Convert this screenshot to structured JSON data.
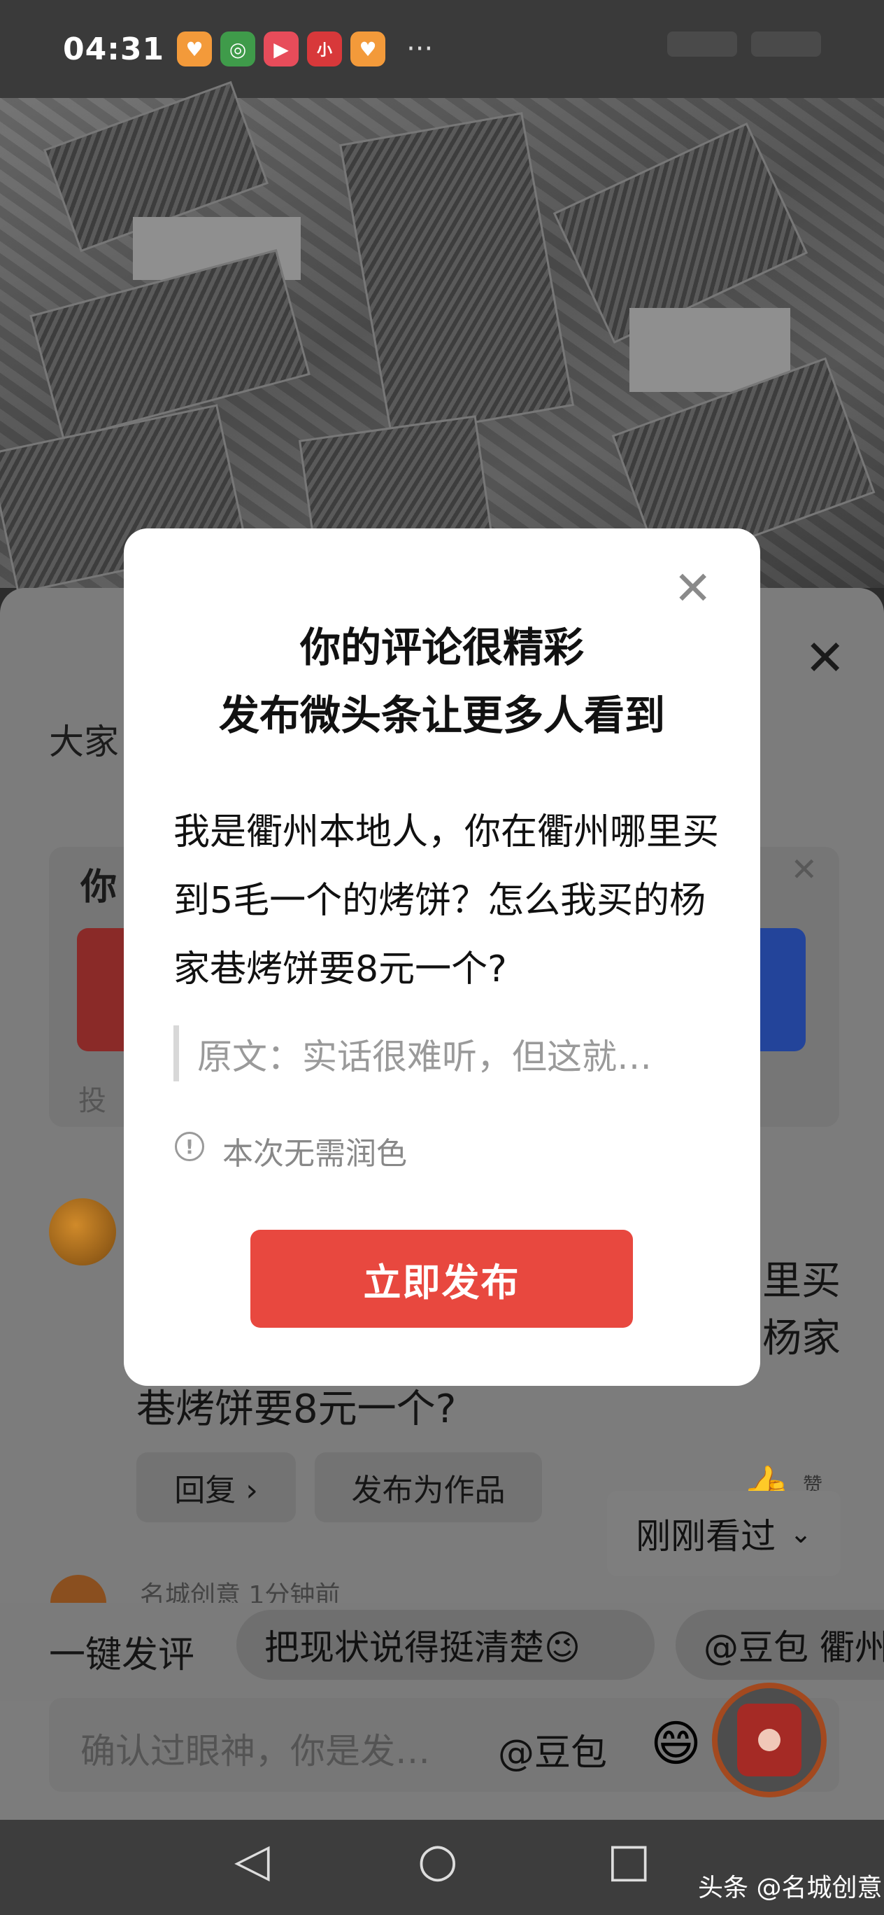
{
  "status_bar": {
    "time": "04:31",
    "more": "···",
    "app_icons": [
      {
        "name": "app-heart-icon",
        "color": "#f39a3a",
        "glyph": "♥"
      },
      {
        "name": "app-leaf-icon",
        "color": "#3f9b4a",
        "glyph": "◎"
      },
      {
        "name": "app-play-icon",
        "color": "#e74c5a",
        "glyph": "▶"
      },
      {
        "name": "app-xiaohongshu-icon",
        "color": "#d8383a",
        "glyph": "小"
      },
      {
        "name": "app-heart2-icon",
        "color": "#f39a3a",
        "glyph": "♥"
      }
    ]
  },
  "sheet": {
    "heading": "大家",
    "vote_question": "你",
    "vote_meta": "投",
    "comment_right_1": "里买",
    "comment_right_2": "杨家",
    "comment_line_3": "巷烤饼要8元一个?",
    "reply_label": "回复 ›",
    "publish_as_work_label": "发布为作品",
    "like_label": "赞",
    "just_seen_label": "刚刚看过",
    "author_line": "名城创意  1分钟前"
  },
  "quick_comments": {
    "label": "一键发评",
    "chips": [
      "把现状说得挺清楚😉",
      "@豆包 衢州"
    ]
  },
  "input": {
    "placeholder": "确认过眼神，你是发…",
    "mention": "@豆包",
    "emoji": "😄"
  },
  "watermark": "头条 @名城创意",
  "modal": {
    "title_line1": "你的评论很精彩",
    "title_line2": "发布微头条让更多人看到",
    "body": "我是衢州本地人，你在衢州哪里买到5毛一个的烤饼？怎么我买的杨家巷烤饼要8元一个?",
    "quote": "原文：实话很难听，但这就…",
    "info": "本次无需润色",
    "publish_button": "立即发布",
    "accent_color": "#e8483f"
  }
}
